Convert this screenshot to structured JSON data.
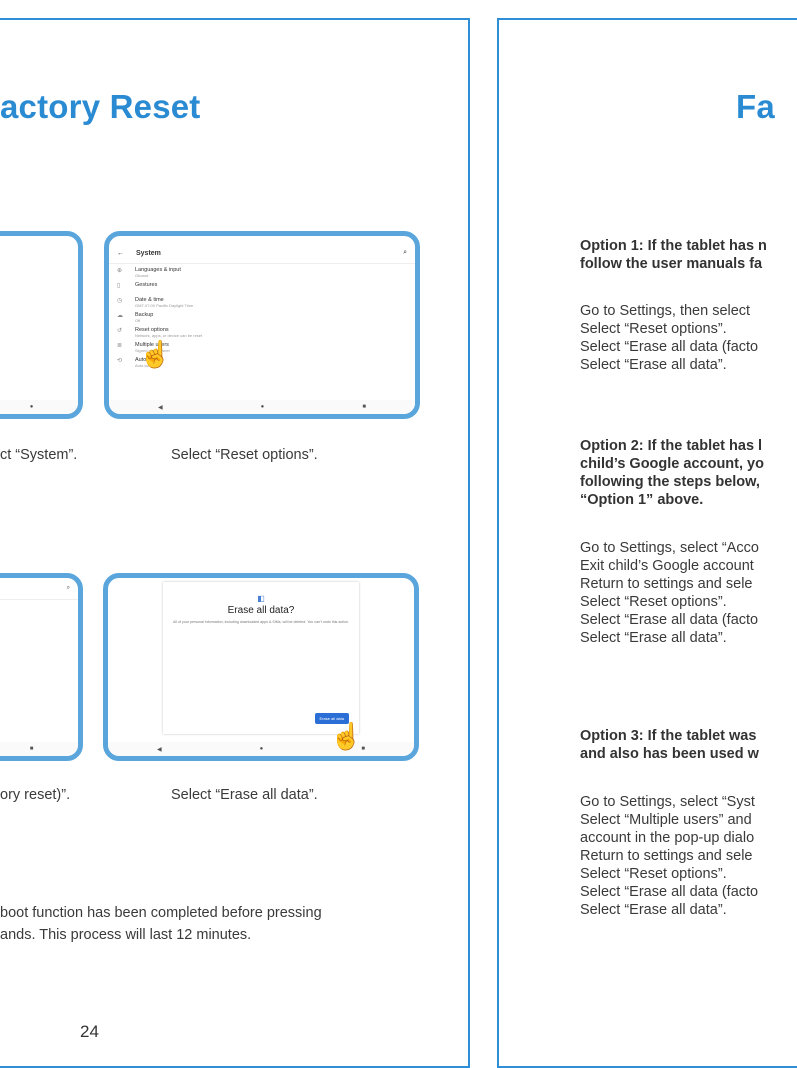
{
  "left_page": {
    "title": "actory Reset",
    "page_number": "24",
    "captions": {
      "top_left": "ct “System”.",
      "top_right": "Select “Reset options”.",
      "bottom_left": "ory reset)”.",
      "bottom_right": "Select “Erase all data”."
    },
    "note_lines": [
      "boot function has been completed before pressing",
      "ands. This process will last 12 minutes."
    ],
    "screen_system": {
      "header": "System",
      "rows": [
        {
          "label": "Languages & input",
          "sub": "Gboard"
        },
        {
          "label": "Gestures",
          "sub": ""
        },
        {
          "label": "Date & time",
          "sub": "GMT-07:00 Pacific Daylight Time"
        },
        {
          "label": "Backup",
          "sub": "Off"
        },
        {
          "label": "Reset options",
          "sub": "Network, apps, or device can be reset"
        },
        {
          "label": "Multiple users",
          "sub": "Signed in as Owner"
        },
        {
          "label": "Auto-turn",
          "sub": "Auto-turn"
        }
      ]
    },
    "screen_erase": {
      "dialog_title": "Erase all data?",
      "dialog_body": "All of your personal information, including downloaded apps & SIMs, will be deleted. You can't undo this action.",
      "button": "Erase all data"
    }
  },
  "right_page": {
    "title": "Fa",
    "option1_heading": [
      "Option 1: If the tablet has n",
      "follow the user manuals fa"
    ],
    "option1_steps": [
      "Go to Settings, then select",
      "Select “Reset options”.",
      "Select “Erase all data (facto",
      "Select “Erase all data”."
    ],
    "option2_heading": [
      "Option 2: If the tablet has l",
      "child’s Google account, yo",
      "following the steps below,",
      "“Option 1” above."
    ],
    "option2_steps": [
      "Go to Settings, select “Acco",
      "Exit child’s Google account",
      "Return to settings and sele",
      "Select “Reset options”.",
      "Select “Erase all data (facto",
      "Select “Erase all data”."
    ],
    "option3_heading": [
      "Option 3: If the tablet was",
      "and also has  been used w"
    ],
    "option3_steps": [
      "Go to Settings, select “Syst",
      "Select “Multiple users” and",
      "account in the pop-up dialo",
      "Return to settings and sele",
      "Select “Reset options”.",
      "Select “Erase all data (facto",
      "Select “Erase all data”."
    ]
  },
  "colors": {
    "accent": "#2a8bd3",
    "border": "#2f8fd6",
    "tablet_frame": "#5aa6dc"
  }
}
